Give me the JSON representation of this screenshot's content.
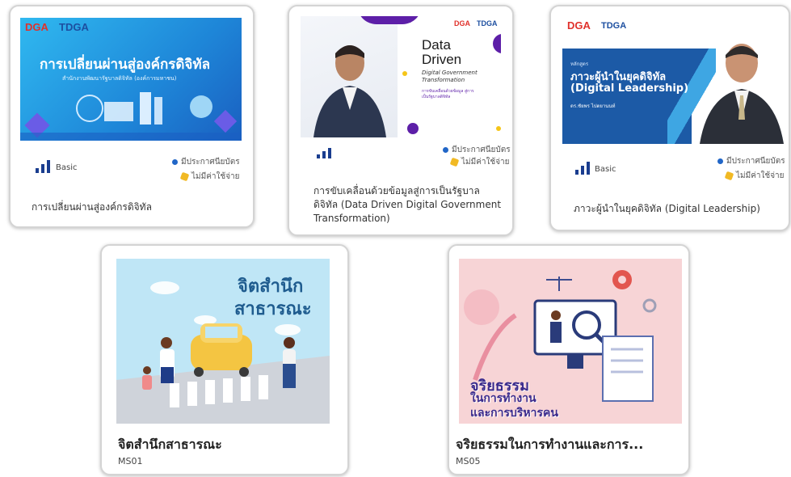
{
  "cards": [
    {
      "banner_logo1": "DGA",
      "banner_logo2": "TDGA",
      "banner_heading": "การเปลี่ยนผ่านสู่องค์กรดิจิทัล",
      "banner_sub": "สำนักงานพัฒนารัฐบาลดิจิทัล (องค์การมหาชน)",
      "level": "Basic",
      "cert": "มีประกาศนียบัตร",
      "fee": "ไม่มีค่าใช้จ่าย",
      "title": "การเปลี่ยนผ่านสู่องค์กรดิจิทัล"
    },
    {
      "banner_logo1": "DGA",
      "banner_logo2": "TDGA",
      "banner_heading_line1": "Data",
      "banner_heading_line2": "Driven",
      "banner_sub": "Digital Government Transformation",
      "banner_sub2": "การขับเคลื่อนด้วยข้อมูล สู่การเป็นรัฐบาลดิจิทัล",
      "cert": "มีประกาศนียบัตร",
      "fee": "ไม่มีค่าใช้จ่าย",
      "title_line1": "การขับเคลื่อนด้วยข้อมูลสู่การเป็นรัฐบาล",
      "title_line2": "ดิจิทัล (Data Driven Digital Government",
      "title_line3": "Transformation)"
    },
    {
      "banner_logo1": "DGA",
      "banner_logo2": "TDGA",
      "banner_kicker": "หลักสูตร",
      "banner_heading_line1": "ภาวะผู้นำในยุคดิจิทัล",
      "banner_heading_line2": "(Digital Leadership)",
      "banner_speaker": "ดร.ชัยพร ไปตยานนท์",
      "level": "Basic",
      "cert": "มีประกาศนียบัตร",
      "fee": "ไม่มีค่าใช้จ่าย",
      "title": "ภาวะผู้นำในยุคดิจิทัล (Digital Leadership)"
    },
    {
      "banner_heading_line1": "จิตสำนึก",
      "banner_heading_line2": "สาธารณะ",
      "title": "จิตสำนึกสาธารณะ",
      "code": "MS01"
    },
    {
      "banner_heading_line1": "จริยธรรม",
      "banner_heading_line2": "ในการทำงาน",
      "banner_heading_line3": "และการบริหารคน",
      "title": "จริยธรรมในการทำงานและการ...",
      "code": "MS05"
    }
  ],
  "colors": {
    "dga_red": "#e0312b",
    "dga_blue": "#1d4fa0",
    "cert_blue": "#2166c7",
    "coin_gold": "#f1b924"
  }
}
